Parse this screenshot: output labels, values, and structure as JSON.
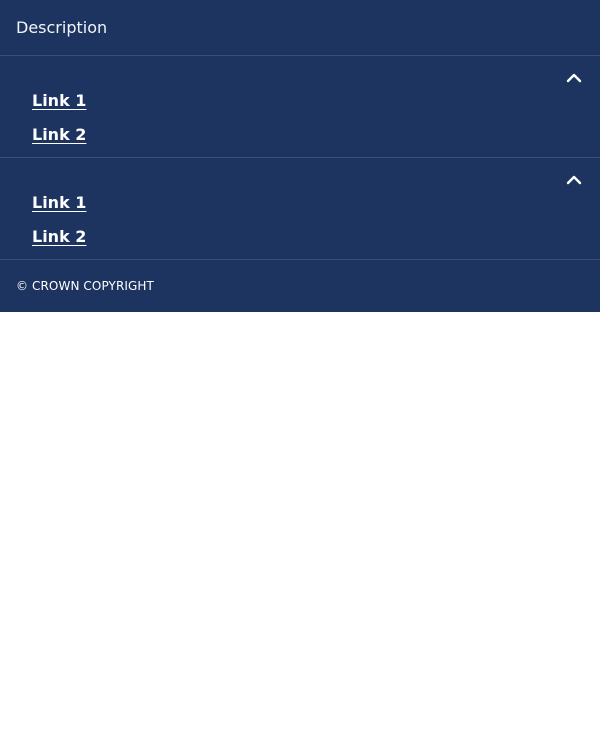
{
  "footer": {
    "description": "Description",
    "sections": [
      {
        "toggle_icon": "chevron-up-icon",
        "links": [
          "Link 1",
          "Link 2"
        ]
      },
      {
        "toggle_icon": "chevron-up-icon",
        "links": [
          "Link 1",
          "Link 2"
        ]
      }
    ],
    "copyright": "© CROWN COPYRIGHT"
  },
  "colors": {
    "footer_background": "#1d3461",
    "divider": "#3b4f78",
    "text": "#ffffff",
    "page_background": "#ffffff"
  }
}
